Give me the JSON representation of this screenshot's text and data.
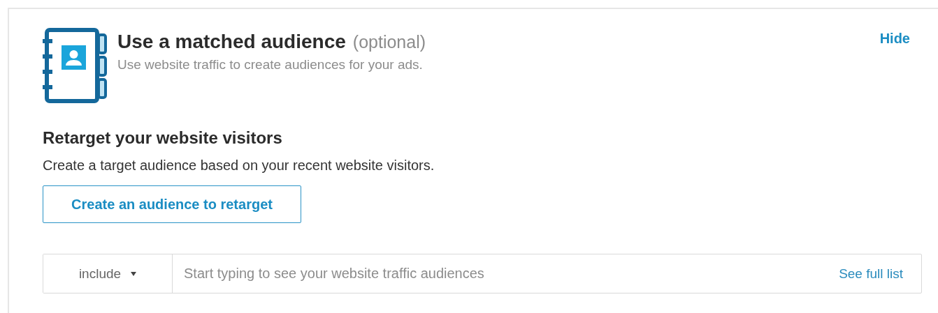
{
  "header": {
    "title": "Use a matched audience",
    "title_note": "(optional)",
    "subtitle": "Use website traffic to create audiences for your ads.",
    "hide_link": "Hide"
  },
  "retarget": {
    "heading": "Retarget your website visitors",
    "description": "Create a target audience based on your recent website visitors.",
    "button": "Create an audience to retarget"
  },
  "filter": {
    "mode": "include",
    "placeholder": "Start typing to see your website traffic audiences",
    "link": "See full list"
  }
}
